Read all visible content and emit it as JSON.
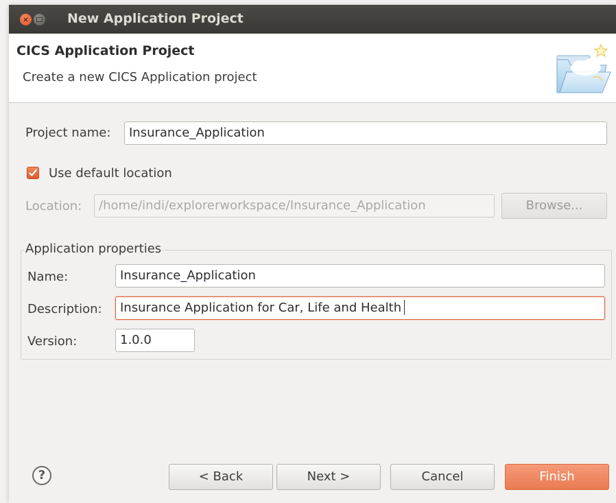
{
  "window": {
    "title": "New Application Project"
  },
  "banner": {
    "title": "CICS Application Project",
    "description": "Create a new CICS Application project",
    "icon": "new-project-folder-icon"
  },
  "form": {
    "project_name_label": "Project name:",
    "project_name_value": "Insurance_Application",
    "use_default_location_label": "Use default location",
    "use_default_location_checked": true,
    "location_label": "Location:",
    "location_value": "/home/indi/explorerworkspace/Insurance_Application",
    "browse_label": "Browse..."
  },
  "app_properties": {
    "group_label": "Application properties",
    "name_label": "Name:",
    "name_value": "Insurance_Application",
    "description_label": "Description:",
    "description_value": "Insurance Application for Car, Life and Health",
    "version_label": "Version:",
    "version_value": "1.0.0"
  },
  "footer": {
    "help_icon": "?",
    "back_label": "< Back",
    "next_label": "Next >",
    "cancel_label": "Cancel",
    "finish_label": "Finish"
  },
  "colors": {
    "accent": "#ea7b52",
    "titlebar": "#3c3b37"
  }
}
